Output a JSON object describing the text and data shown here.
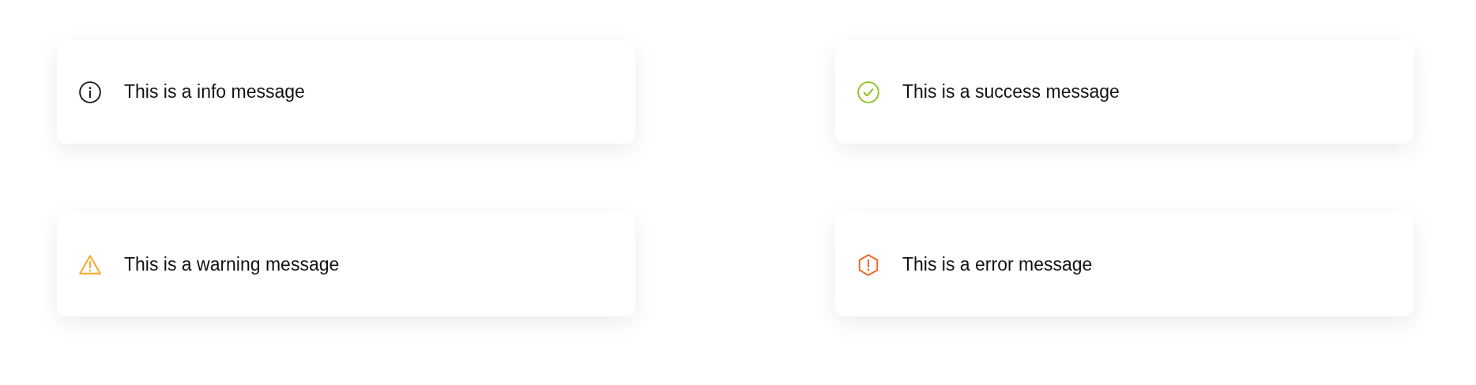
{
  "messages": [
    {
      "kind": "info",
      "text": "This is a info message",
      "color": "#1a1a1a"
    },
    {
      "kind": "success",
      "text": "This is a success message",
      "color": "#8cc21f"
    },
    {
      "kind": "warning",
      "text": "This is a warning message",
      "color": "#f5a623"
    },
    {
      "kind": "error",
      "text": "This is a error message",
      "color": "#f26522"
    }
  ]
}
